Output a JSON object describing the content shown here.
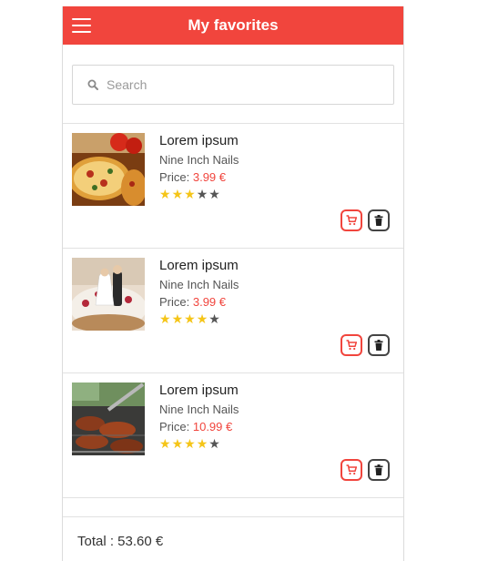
{
  "header": {
    "title": "My favorites",
    "menu_icon": "menu-icon"
  },
  "search": {
    "placeholder": "Search",
    "icon": "search-icon"
  },
  "items": [
    {
      "name": "Lorem ipsum",
      "artist": "Nine Inch Nails",
      "price_label": "Price:",
      "price": "3.99 €",
      "rating": 3,
      "max_rating": 5,
      "image": "pizza-image"
    },
    {
      "name": "Lorem ipsum",
      "artist": "Nine Inch Nails",
      "price_label": "Price:",
      "price": "3.99 €",
      "rating": 4,
      "max_rating": 5,
      "image": "wedding-cake-image"
    },
    {
      "name": "Lorem ipsum",
      "artist": "Nine Inch Nails",
      "price_label": "Price:",
      "price": "10.99 €",
      "rating": 4,
      "max_rating": 5,
      "image": "barbecue-image"
    }
  ],
  "footer": {
    "total": "Total : 53.60 €"
  },
  "colors": {
    "accent": "#f1453d",
    "star": "#f5c518",
    "star_empty": "#555555"
  }
}
